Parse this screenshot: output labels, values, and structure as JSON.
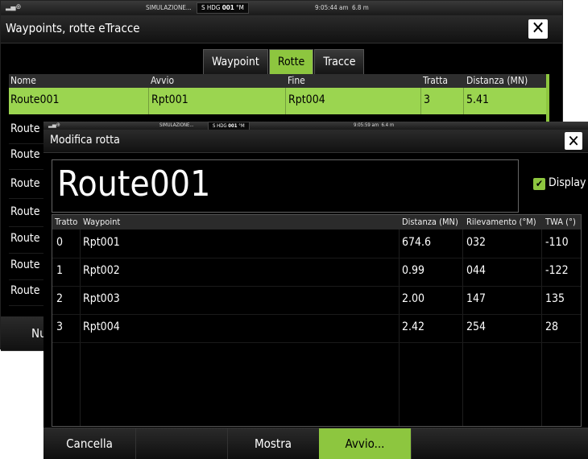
{
  "back": {
    "status": {
      "sim": "SIMULAZIONE...",
      "hdg_prefix": "S HDG",
      "hdg_value": "001",
      "hdg_unit": "°M",
      "time": "9:05:44 am",
      "depth": "6.8 m"
    },
    "title": "Waypoints, rotte eTracce",
    "tabs": [
      "Waypoint",
      "Rotte",
      "Tracce"
    ],
    "active_tab": "Rotte",
    "columns": [
      "Nome",
      "Avvio",
      "Fine",
      "Tratta",
      "Distanza (MN)"
    ],
    "selected_row": [
      "Route001",
      "Rpt001",
      "Rpt004",
      "3",
      "5.41"
    ],
    "other_rows": [
      "Route",
      "Route",
      "Route",
      "Route",
      "Route",
      "Route",
      "Route"
    ],
    "bottom_partial": "Nu"
  },
  "front": {
    "status": {
      "sim": "SIMULAZIONE...",
      "hdg_prefix": "S HDG",
      "hdg_value": "001",
      "hdg_unit": "°M",
      "time": "9:05:59 am",
      "depth": "6.4 m"
    },
    "title": "Modifica rotta",
    "route_name": "Route001",
    "display_label": "Display",
    "display_checked": true,
    "columns": [
      "Tratto",
      "Waypoint",
      "Distanza (MN)",
      "Rilevamento (°M)",
      "TWA (°)"
    ],
    "rows": [
      [
        "0",
        "Rpt001",
        "674.6",
        "032",
        "-110"
      ],
      [
        "1",
        "Rpt002",
        "0.99",
        "044",
        "-122"
      ],
      [
        "2",
        "Rpt003",
        "2.00",
        "147",
        "135"
      ],
      [
        "3",
        "Rpt004",
        "2.42",
        "254",
        "28"
      ]
    ],
    "buttons": [
      "Cancella",
      "",
      "Mostra",
      "Avvio...",
      ""
    ]
  },
  "colors": {
    "accent": "#8dc63f",
    "selected_row": "#9bd550",
    "background": "#000000"
  }
}
